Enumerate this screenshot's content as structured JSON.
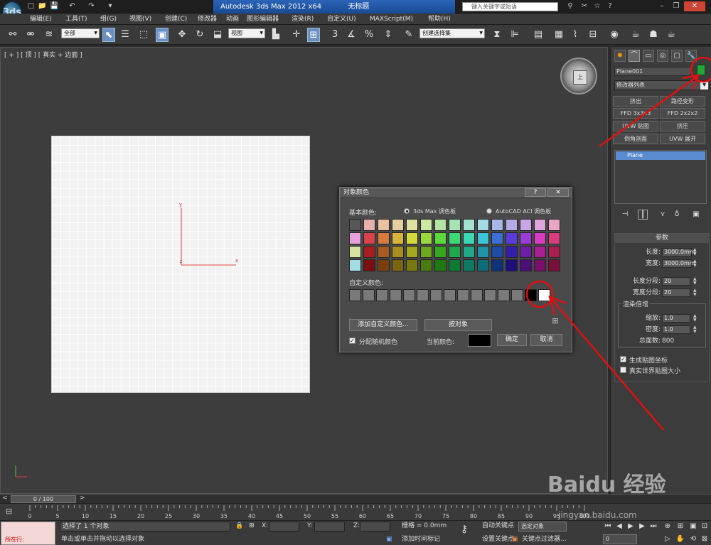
{
  "app": {
    "icon_label": "3ds",
    "title": "Autodesk 3ds Max  2012 x64",
    "doc_title": "无标题",
    "search_placeholder": "键入关键字或短语"
  },
  "quick_access": [
    "▢",
    "📁",
    "💾",
    "↶",
    "↷",
    "▾"
  ],
  "menu": [
    "编辑(E)",
    "工具(T)",
    "组(G)",
    "视图(V)",
    "创建(C)",
    "修改器",
    "动画",
    "图形编辑器",
    "渲染(R)",
    "自定义(U)",
    "MAXScript(M)",
    "帮助(H)"
  ],
  "toolbar": {
    "filter": "全部",
    "ref_coord": "视图",
    "selection_set": "创建选择集",
    "snap_angle": "3",
    "pct": "%"
  },
  "viewport": {
    "label": "[ + ] [ 顶 ] [ 真实 + 边面 ]",
    "cube_face": "上"
  },
  "dialog": {
    "title": "对象颜色",
    "help": "?",
    "close": "✕",
    "basic_label": "基本颜色:",
    "opt1": "3ds Max 调色板",
    "opt2": "AutoCAD ACI 调色板",
    "custom_label": "自定义颜色:",
    "add_custom": "添加自定义颜色...",
    "by_object": "按对象",
    "random_label": "分配随机颜色",
    "current_label": "当前颜色:",
    "ok": "确定",
    "cancel": "取消",
    "current_color": "#000000",
    "palette": [
      [
        "#585858",
        "#e6b0b0",
        "#e9c0a0",
        "#e7cf9f",
        "#e0e0a0",
        "#cde7a4",
        "#b3e4a4",
        "#a5e2b4",
        "#a4e2cf",
        "#a5dbe5",
        "#a8b6e8",
        "#b5ace6",
        "#caa5e6",
        "#dfa5dd",
        "#e8a5c4"
      ],
      [
        "#e6a0dc",
        "#d8434b",
        "#d87a3c",
        "#d8b43c",
        "#d5d83c",
        "#9bd83c",
        "#5bd83c",
        "#3cd874",
        "#3cd8b4",
        "#3cc4d8",
        "#3c6fd8",
        "#5b3cd8",
        "#9b3cd8",
        "#d83cc4",
        "#d83c7a"
      ],
      [
        "#d6e2a0",
        "#a81f1f",
        "#a85a1f",
        "#a88e1f",
        "#a5a81f",
        "#6ea81f",
        "#36a81f",
        "#1fa84c",
        "#1fa88a",
        "#1f94a8",
        "#1f4ca8",
        "#361fa8",
        "#6e1fa8",
        "#a81f94",
        "#a81f52"
      ],
      [
        "#a0dce2",
        "#7a0f0f",
        "#7a3f0f",
        "#7a640f",
        "#77790f",
        "#4b7a0f",
        "#1e7a0f",
        "#0f7a33",
        "#0f7a62",
        "#0f6b7a",
        "#0f337a",
        "#1e0f7a",
        "#4b0f7a",
        "#7a0f6b",
        "#7a0f39"
      ]
    ],
    "custom_colors": [
      "#7a7a7a",
      "#7a7a7a",
      "#7a7a7a",
      "#7a7a7a",
      "#7a7a7a",
      "#7a7a7a",
      "#7a7a7a",
      "#7a7a7a",
      "#7a7a7a",
      "#7a7a7a",
      "#7a7a7a",
      "#7a7a7a",
      "#7a7a7a",
      "#000000",
      "#ffffff"
    ]
  },
  "cmd_panel": {
    "tabs": [
      "✸",
      "⌒",
      "▭",
      "◎",
      "▢",
      "🔧"
    ],
    "object_name": "Plane001",
    "object_color": "#21a63a",
    "modifier_list": "修改器列表",
    "mod_buttons": [
      "挤出",
      "路径变形",
      "FFD 3x3x3",
      "FFD 2x2x2",
      "UVW 贴图",
      "挤压",
      "倒角剖面",
      "UVW 展开"
    ],
    "stack_item": "Plane",
    "params_header": "参数",
    "length_label": "长度:",
    "length": "3000.0mm",
    "width_label": "宽度:",
    "width": "3000.0mm",
    "lsegs_label": "长度分段:",
    "lsegs": "20",
    "wsegs_label": "宽度分段:",
    "wsegs": "20",
    "render_mult": "渲染倍增",
    "scale_label": "缩放:",
    "scale": "1.0",
    "density_label": "密度:",
    "density": "1.0",
    "faces_label": "总面数:",
    "faces": "800",
    "gen_map": "生成贴图坐标",
    "real_world": "真实世界贴图大小"
  },
  "timeline": {
    "slider": "0 / 100",
    "ticks": [
      "0",
      "5",
      "10",
      "15",
      "20",
      "25",
      "30",
      "35",
      "40",
      "45",
      "50",
      "55",
      "60",
      "65",
      "70",
      "75",
      "80",
      "85",
      "90",
      "95",
      "100"
    ]
  },
  "status": {
    "maxscript": "所在行:",
    "msg1": "选择了 1 个对象",
    "msg2": "单击或单击并拖动以选择对象",
    "x": "X:",
    "y": "Y:",
    "z": "Z:",
    "grid": "栅格 = 0.0mm",
    "add_marker": "添加时间标记",
    "autokey": "自动关键点",
    "setkey": "设置关键点",
    "selected": "选定对象",
    "keyfilter": "关键点过滤器...",
    "frame": "0"
  },
  "watermark": {
    "brand": "Baidu 经验",
    "url": "jingyan.baidu.com"
  }
}
